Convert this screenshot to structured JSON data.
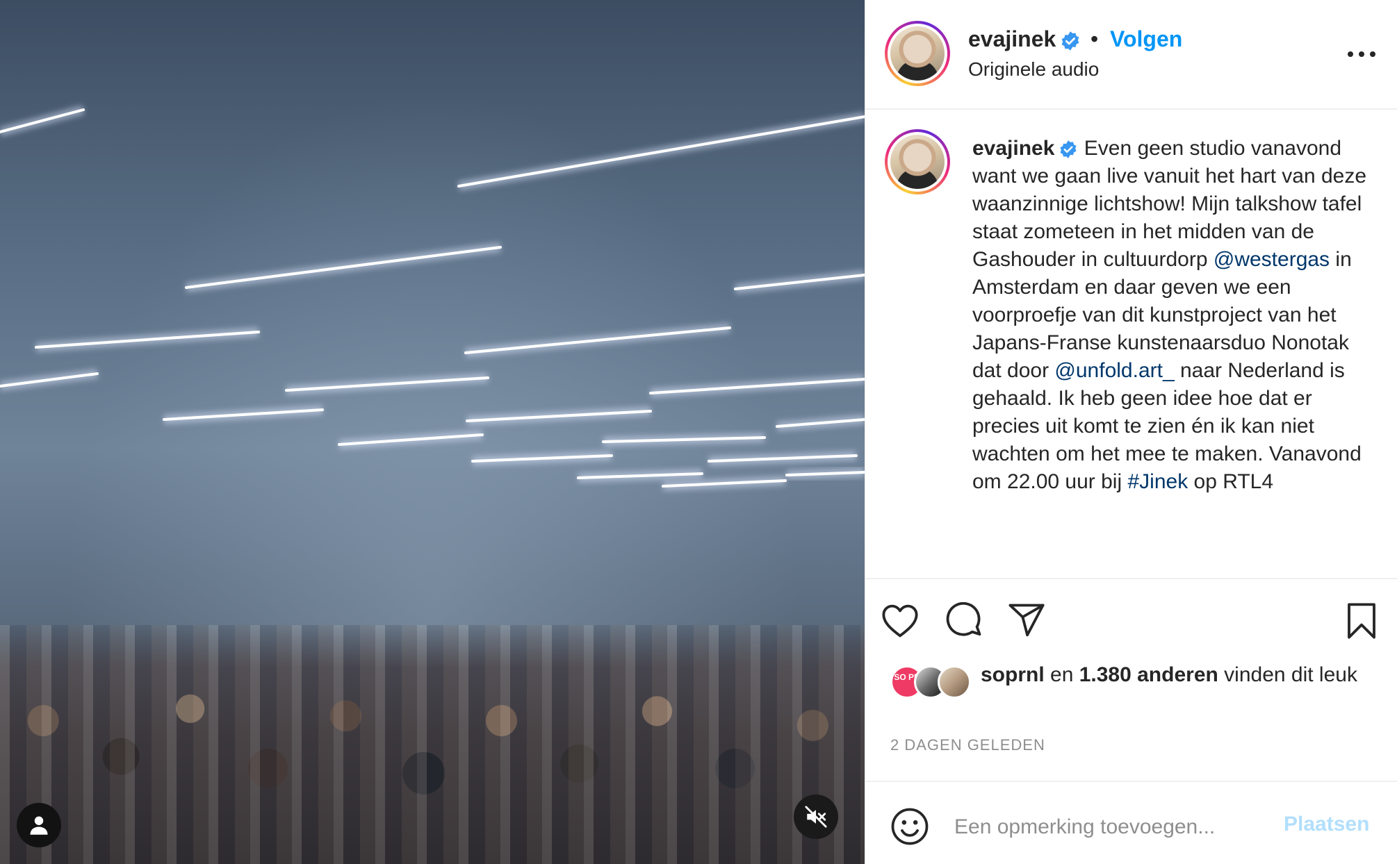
{
  "media": {
    "type": "video",
    "user_tag_icon": "user-icon",
    "mute_icon": "speaker-muted-icon"
  },
  "header": {
    "username": "evajinek",
    "verified_icon": "verified-badge-icon",
    "separator": "•",
    "follow_label": "Volgen",
    "audio_label": "Originele audio",
    "more_icon": "more-horizontal-icon"
  },
  "caption": {
    "username": "evajinek",
    "segments": [
      {
        "type": "text",
        "text": " Even geen studio vanavond want we gaan live vanuit het hart van deze waanzinnige lichtshow! Mijn talkshow tafel staat zometeen in het midden van de Gashouder in cultuurdorp "
      },
      {
        "type": "link",
        "text": "@westergas"
      },
      {
        "type": "text",
        "text": " in Amsterdam en daar geven we een voorproefje van dit kunstproject van het Japans-Franse kunstenaarsduo Nonotak dat door "
      },
      {
        "type": "link",
        "text": "@unfold.art_"
      },
      {
        "type": "text",
        "text": " naar Nederland is gehaald. Ik heb geen idee hoe dat er precies uit komt te zien én ik kan niet wachten om het mee te maken. Vanavond om 22.00 uur bij "
      },
      {
        "type": "link",
        "text": "#Jinek"
      },
      {
        "type": "text",
        "text": " op RTL4"
      }
    ]
  },
  "actions": {
    "like_icon": "heart-icon",
    "comment_icon": "comment-icon",
    "share_icon": "paper-plane-icon",
    "save_icon": "bookmark-icon"
  },
  "likes": {
    "first_avatar_text": "SO PR",
    "first_user": "soprnl",
    "connector": " en ",
    "others": "1.380 anderen",
    "suffix": " vinden dit leuk"
  },
  "timestamp": "2 DAGEN GELEDEN",
  "comment": {
    "emoji_icon": "smiley-icon",
    "placeholder": "Een opmerking toevoegen...",
    "post_label": "Plaatsen"
  },
  "colors": {
    "accent": "#0095f6",
    "link": "#00376b",
    "muted": "#8e8e8e",
    "post_disabled": "#b2dffc"
  }
}
